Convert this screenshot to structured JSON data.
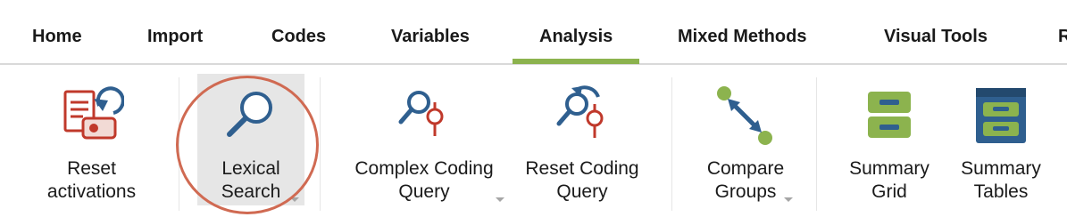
{
  "tabs": [
    {
      "label": "Home"
    },
    {
      "label": "Import"
    },
    {
      "label": "Codes"
    },
    {
      "label": "Variables"
    },
    {
      "label": "Analysis",
      "active": true
    },
    {
      "label": "Mixed Methods"
    },
    {
      "label": "Visual Tools"
    },
    {
      "label": "R"
    }
  ],
  "ribbon": {
    "reset_activations": {
      "line1": "Reset",
      "line2": "activations",
      "icon": "reset-activations-icon"
    },
    "lexical_search": {
      "line1": "Lexical",
      "line2": "Search",
      "icon": "magnifier-icon",
      "has_dropdown": true
    },
    "complex_coding_query": {
      "line1": "Complex Coding",
      "line2": "Query",
      "icon": "coding-query-icon",
      "has_dropdown": true
    },
    "reset_coding_query": {
      "line1": "Reset Coding",
      "line2": "Query",
      "icon": "reset-coding-query-icon"
    },
    "compare_groups": {
      "line1": "Compare",
      "line2": "Groups",
      "icon": "compare-arrows-icon",
      "has_dropdown": true
    },
    "summary_grid": {
      "line1": "Summary",
      "line2": "Grid",
      "icon": "summary-grid-icon"
    },
    "summary_tables": {
      "line1": "Summary",
      "line2": "Tables",
      "icon": "summary-tables-icon"
    }
  },
  "colors": {
    "accent_green": "#8cb34e",
    "icon_red": "#c0392b",
    "icon_blue": "#2f5f8f",
    "highlight_circle": "#d06a52"
  }
}
